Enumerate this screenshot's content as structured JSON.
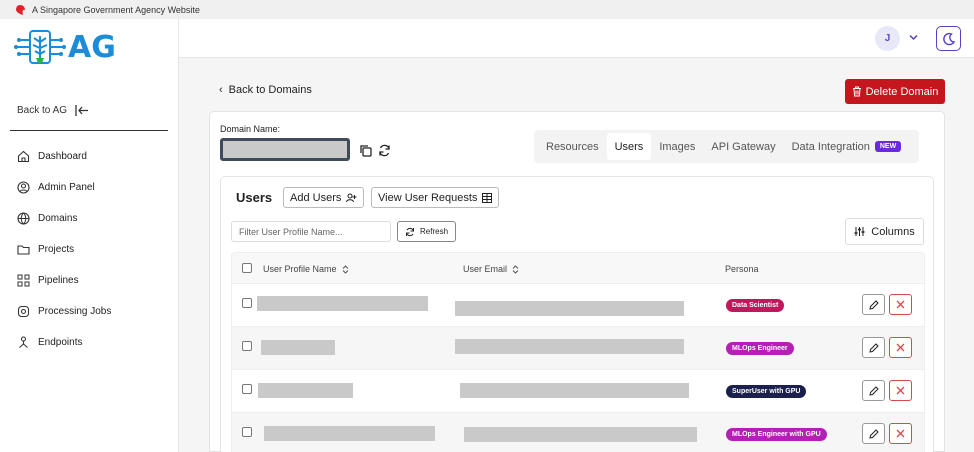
{
  "gov_banner": {
    "text": "A Singapore Government Agency Website",
    "icon": "lion-head-icon"
  },
  "logo": {
    "text": "AG"
  },
  "sidebar": {
    "back_label": "Back to AG",
    "items": [
      {
        "label": "Dashboard",
        "icon": "home-icon"
      },
      {
        "label": "Admin Panel",
        "icon": "user-circle-icon"
      },
      {
        "label": "Domains",
        "icon": "globe-icon"
      },
      {
        "label": "Projects",
        "icon": "folder-icon"
      },
      {
        "label": "Pipelines",
        "icon": "pipeline-icon"
      },
      {
        "label": "Processing Jobs",
        "icon": "gear-icon"
      },
      {
        "label": "Endpoints",
        "icon": "endpoint-icon"
      }
    ]
  },
  "header": {
    "avatar_initial": "J"
  },
  "main": {
    "back_label": "Back to Domains",
    "delete_label": "Delete Domain",
    "domain_name_label": "Domain Name:",
    "tabs": [
      {
        "label": "Resources"
      },
      {
        "label": "Users",
        "active": true
      },
      {
        "label": "Images"
      },
      {
        "label": "API Gateway"
      },
      {
        "label": "Data Integration",
        "badge": "NEW"
      }
    ]
  },
  "users": {
    "title": "Users",
    "add_label": "Add Users",
    "view_requests_label": "View User Requests",
    "filter_placeholder": "Filter User Profile Name...",
    "refresh_label": "Refresh",
    "columns_label": "Columns",
    "headers": {
      "name": "User Profile Name",
      "email": "User Email",
      "persona": "Persona"
    },
    "rows": [
      {
        "persona": "Data Scientist",
        "persona_color": "#c2185b"
      },
      {
        "persona": "MLOps Engineer",
        "persona_color": "#b41fb4"
      },
      {
        "persona": "SuperUser with GPU",
        "persona_color": "#1a1f4d"
      },
      {
        "persona": "MLOps Engineer with GPU",
        "persona_color": "#b41fb4"
      }
    ]
  },
  "colors": {
    "brand": "#1a8cd8",
    "danger": "#c4161c",
    "accent": "#5b3fc4",
    "new_badge": "#6b2bd9"
  }
}
